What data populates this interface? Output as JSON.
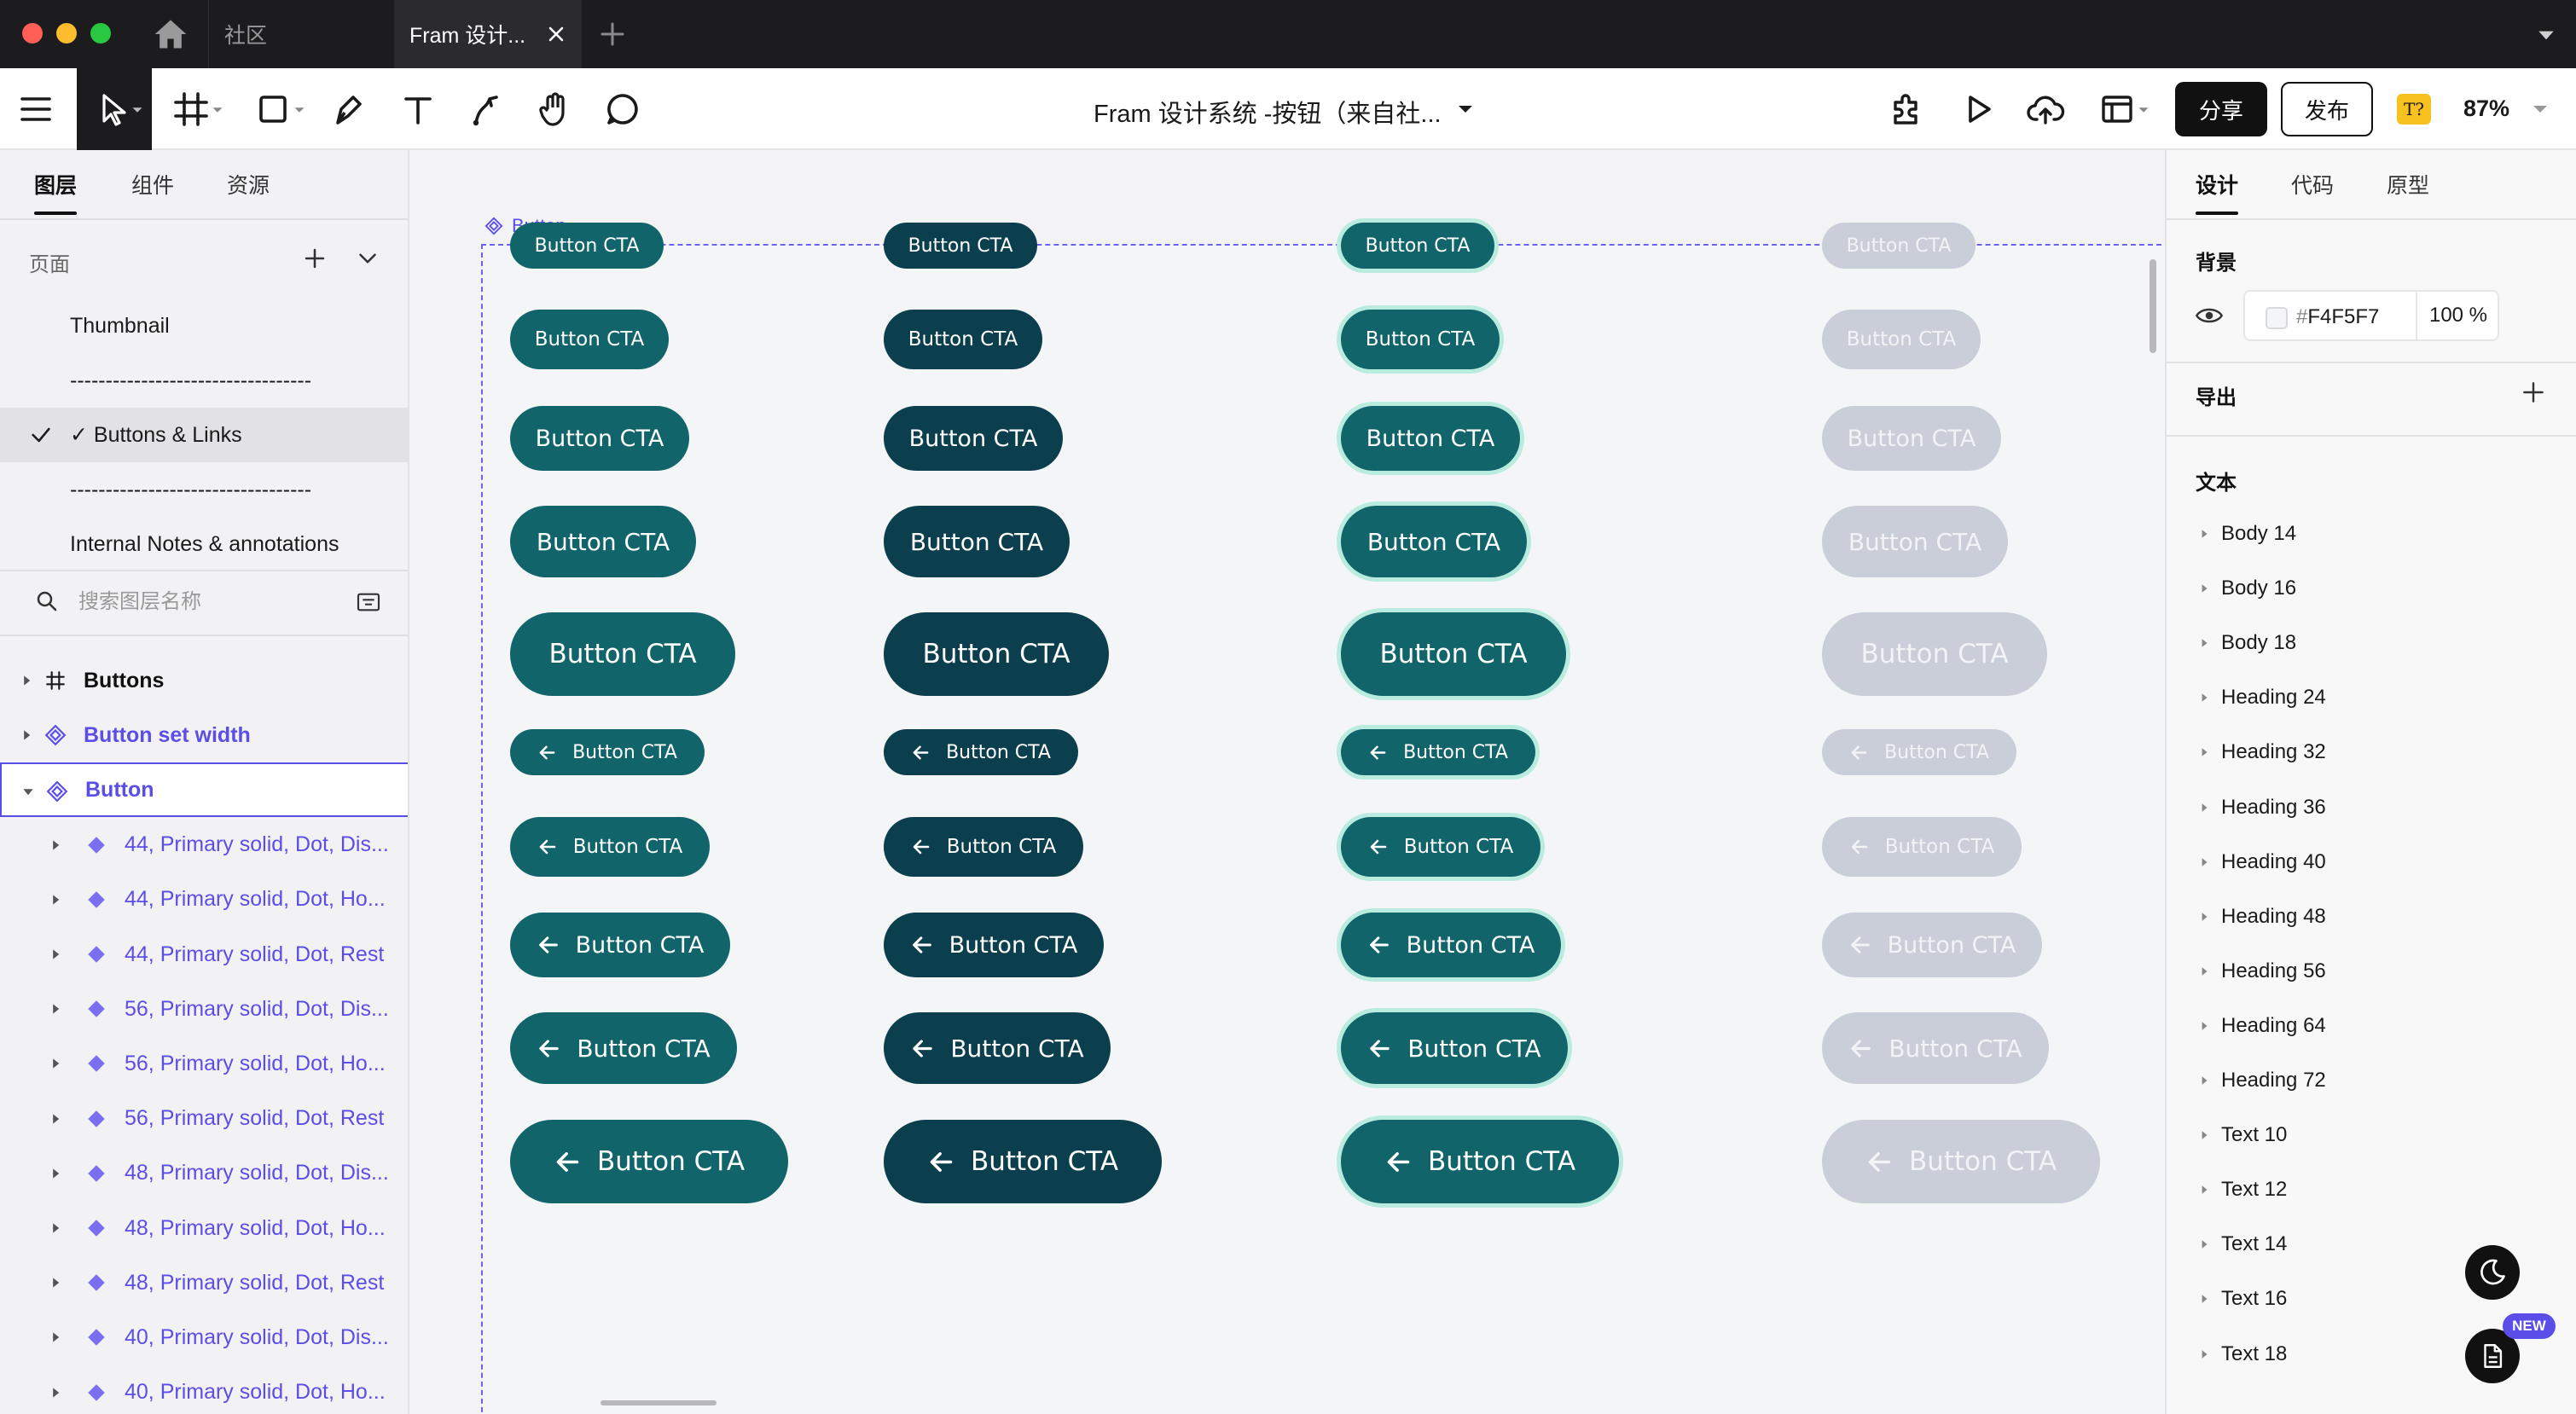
{
  "window": {
    "tabs": [
      {
        "label": "社区"
      },
      {
        "label": "Fram 设计..."
      }
    ]
  },
  "toolbar": {
    "doc_title": "Fram 设计系统 -按钮（来自社...",
    "share_label": "分享",
    "publish_label": "发布",
    "font_badge": "T?",
    "zoom": "87%"
  },
  "left_panel": {
    "tabs": [
      {
        "label": "图层",
        "active": true
      },
      {
        "label": "组件",
        "active": false
      },
      {
        "label": "资源",
        "active": false
      }
    ],
    "pages_label": "页面",
    "pages": [
      {
        "label": "Thumbnail",
        "active": false
      },
      {
        "label": "----------------------------------",
        "active": false
      },
      {
        "label": "✓ Buttons & Links",
        "active": true
      },
      {
        "label": "----------------------------------",
        "active": false
      },
      {
        "label": "Internal Notes & annotations",
        "active": false
      }
    ],
    "search_placeholder": "搜索图层名称",
    "layers": [
      {
        "label": "Buttons",
        "type": "frame",
        "expanded": false,
        "selected": false
      },
      {
        "label": "Button set width",
        "type": "component-set",
        "expanded": false,
        "selected": false
      },
      {
        "label": "Button",
        "type": "component-set",
        "expanded": true,
        "selected": true
      },
      {
        "label": "44, Primary solid, Dot, Dis...",
        "type": "variant"
      },
      {
        "label": "44, Primary solid, Dot, Ho...",
        "type": "variant"
      },
      {
        "label": "44, Primary solid, Dot, Rest",
        "type": "variant"
      },
      {
        "label": "56, Primary solid, Dot, Dis...",
        "type": "variant"
      },
      {
        "label": "56, Primary solid, Dot, Ho...",
        "type": "variant"
      },
      {
        "label": "56, Primary solid, Dot, Rest",
        "type": "variant"
      },
      {
        "label": "48, Primary solid, Dot, Dis...",
        "type": "variant"
      },
      {
        "label": "48, Primary solid, Dot, Ho...",
        "type": "variant"
      },
      {
        "label": "48, Primary solid, Dot, Rest",
        "type": "variant"
      },
      {
        "label": "40, Primary solid, Dot, Dis...",
        "type": "variant"
      },
      {
        "label": "40, Primary solid, Dot, Ho...",
        "type": "variant"
      }
    ]
  },
  "canvas": {
    "frame_label": "Button",
    "button_label": "Button CTA",
    "variant_colors": {
      "rest": "#11646a",
      "hover": "#0c3f4d",
      "focus": "#11646a",
      "focus_ring": "#b9ecdf",
      "disabled": "#c9ced8"
    }
  },
  "right_panel": {
    "tabs": [
      {
        "label": "设计",
        "active": true
      },
      {
        "label": "代码",
        "active": false
      },
      {
        "label": "原型",
        "active": false
      }
    ],
    "background_heading": "背景",
    "background_hex_prefix": "#",
    "background_hex": "F4F5F7",
    "background_opacity": "100 %",
    "export_heading": "导出",
    "text_heading": "文本",
    "text_styles": [
      "Body 14",
      "Body 16",
      "Body 18",
      "Heading 24",
      "Heading 32",
      "Heading 36",
      "Heading 40",
      "Heading 48",
      "Heading 56",
      "Heading 64",
      "Heading 72",
      "Text 10",
      "Text 12",
      "Text 14",
      "Text 16",
      "Text 18"
    ],
    "new_badge": "NEW"
  }
}
